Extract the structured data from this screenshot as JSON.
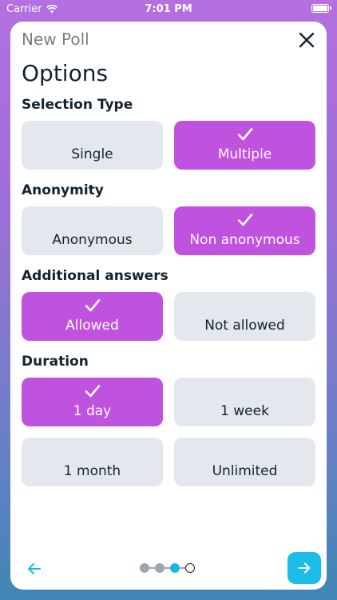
{
  "status_bar": {
    "carrier": "Carrier",
    "time": "7:01 PM"
  },
  "header": {
    "title": "New Poll",
    "heading": "Options"
  },
  "sections": {
    "selection_type": {
      "label": "Selection Type",
      "options": [
        {
          "label": "Single",
          "selected": false
        },
        {
          "label": "Multiple",
          "selected": true
        }
      ]
    },
    "anonymity": {
      "label": "Anonymity",
      "options": [
        {
          "label": "Anonymous",
          "selected": false
        },
        {
          "label": "Non anonymous",
          "selected": true
        }
      ]
    },
    "additional_answers": {
      "label": "Additional answers",
      "options": [
        {
          "label": "Allowed",
          "selected": true
        },
        {
          "label": "Not allowed",
          "selected": false
        }
      ]
    },
    "duration": {
      "label": "Duration",
      "options": [
        {
          "label": "1 day",
          "selected": true
        },
        {
          "label": "1 week",
          "selected": false
        },
        {
          "label": "1 month",
          "selected": false
        },
        {
          "label": "Unlimited",
          "selected": false
        }
      ]
    }
  },
  "pagination": {
    "total_steps": 4,
    "current_step": 3
  },
  "colors": {
    "accent": "#c052e0",
    "next_button": "#1bbde6",
    "option_unselected": "#e3e8ef",
    "text_dark": "#132330"
  },
  "icons": {
    "close": "close-icon",
    "check": "check-icon",
    "back": "arrow-left-icon",
    "next": "arrow-right-icon"
  }
}
